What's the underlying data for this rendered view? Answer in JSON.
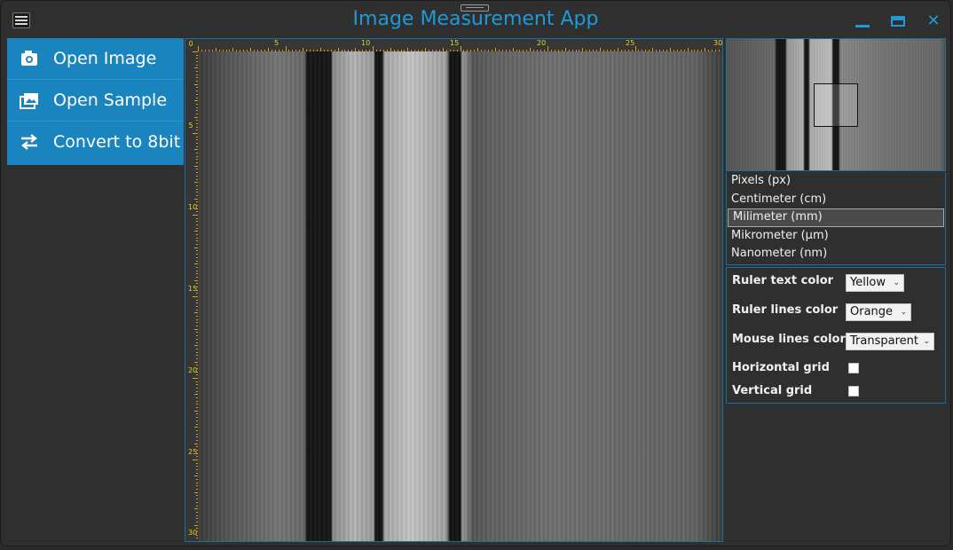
{
  "window": {
    "title": "Image Measurement App",
    "controls": [
      "minimize",
      "maximize",
      "close"
    ],
    "close_glyph": "✕"
  },
  "sidebar": {
    "items": [
      {
        "label": "Open Image",
        "icon": "camera-icon"
      },
      {
        "label": "Open Sample",
        "icon": "images-icon"
      },
      {
        "label": "Convert to 8bit",
        "icon": "swap-arrows-icon"
      }
    ]
  },
  "viewer": {
    "ruler_top_labels": [
      "0",
      "5",
      "10",
      "15",
      "20",
      "25",
      "30"
    ],
    "ruler_left_labels": [
      "0",
      "5",
      "10",
      "15",
      "20",
      "25",
      "30"
    ]
  },
  "units": {
    "options": [
      "Pixels (px)",
      "Centimeter (cm)",
      "Milimeter (mm)",
      "Mikrometer (µm)",
      "Nanometer (nm)"
    ],
    "selected": "Milimeter (mm)"
  },
  "settings": {
    "ruler_text_color": {
      "label": "Ruler text color",
      "value": "Yellow"
    },
    "ruler_lines_color": {
      "label": "Ruler lines color",
      "value": "Orange"
    },
    "mouse_lines_color": {
      "label": "Mouse lines color",
      "value": "Transparent"
    },
    "horizontal_grid": {
      "label": "Horizontal grid",
      "checked": false
    },
    "vertical_grid": {
      "label": "Vertical grid",
      "checked": false
    }
  },
  "colors": {
    "accent": "#1e9ad6",
    "sidebar": "#1a84bf",
    "ruler_text": "#e8d21c",
    "ruler_lines": "#e0a010"
  }
}
